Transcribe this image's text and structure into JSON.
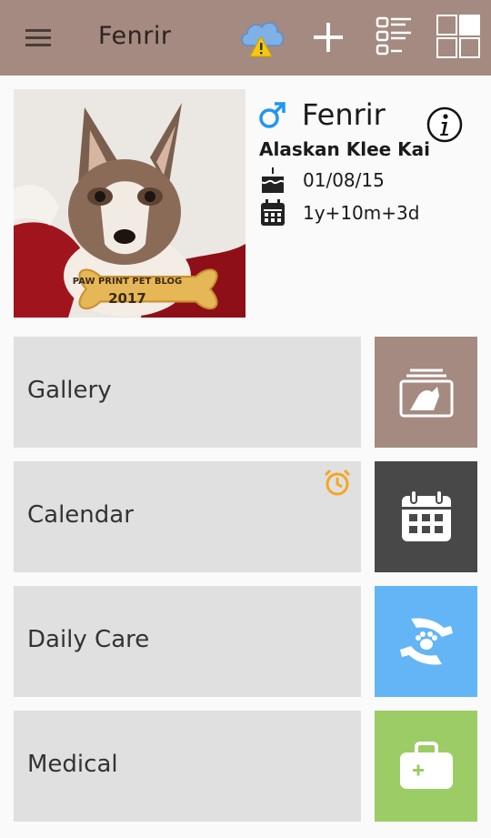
{
  "app_bar": {
    "title": "Fenrir",
    "icons": [
      "menu-icon",
      "cloud-sync-warning-icon",
      "add-icon",
      "list-view-icon",
      "grid-view-icon"
    ]
  },
  "pet": {
    "name": "Fenrir",
    "sex": "male",
    "breed": "Alaskan Klee Kai",
    "birth_date": "01/08/15",
    "age": "1y+10m+3d",
    "photo_badge": {
      "line1": "PAW PRINT PET BLOG",
      "line2": "2017"
    }
  },
  "menu": [
    {
      "label": "Gallery",
      "icon": "gallery-icon",
      "color": "#a48a80"
    },
    {
      "label": "Calendar",
      "icon": "calendar-icon",
      "color": "#484848",
      "badge_icon": "alarm-clock-icon",
      "badge_color": "#f5a623"
    },
    {
      "label": "Daily Care",
      "icon": "paw-hands-icon",
      "color": "#64b5f6"
    },
    {
      "label": "Medical",
      "icon": "medical-kit-icon",
      "color": "#9ccc65"
    }
  ],
  "colors": {
    "app_bar": "#a48a80",
    "male_symbol": "#2196f3",
    "card_bg": "#e0e0e0"
  }
}
